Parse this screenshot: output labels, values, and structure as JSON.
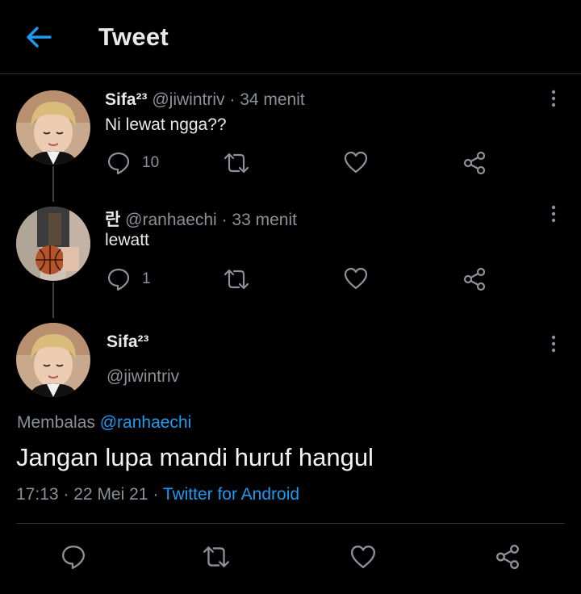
{
  "header": {
    "title": "Tweet",
    "back_icon": "arrow-left-icon",
    "accent": "#1d9bf0"
  },
  "thread": [
    {
      "name": "Sifa²³",
      "handle": "@jiwintriv",
      "sep": "·",
      "time": "34 menit",
      "text": "Ni lewat ngga??",
      "reply_count": "10",
      "avatar": "avatar-blonde-boy"
    },
    {
      "name": "란",
      "handle": "@ranhaechi",
      "sep": "·",
      "time": "33 menit",
      "text": "lewatt",
      "reply_count": "1",
      "avatar": "avatar-basketball"
    }
  ],
  "main_tweet": {
    "name": "Sifa²³",
    "handle": "@jiwintriv",
    "replying_prefix": "Membalas",
    "replying_to": "@ranhaechi",
    "text": "Jangan lupa mandi huruf hangul",
    "time": "17:13",
    "sep": "·",
    "date": "22 Mei 21",
    "source": "Twitter for Android"
  },
  "icons": [
    "reply-icon",
    "retweet-icon",
    "like-icon",
    "share-icon",
    "more-icon"
  ],
  "colors": {
    "background": "#000000",
    "text": "#e7e9ea",
    "muted": "#8b9196",
    "link": "#1d9bf0",
    "divider": "#2f3336"
  }
}
